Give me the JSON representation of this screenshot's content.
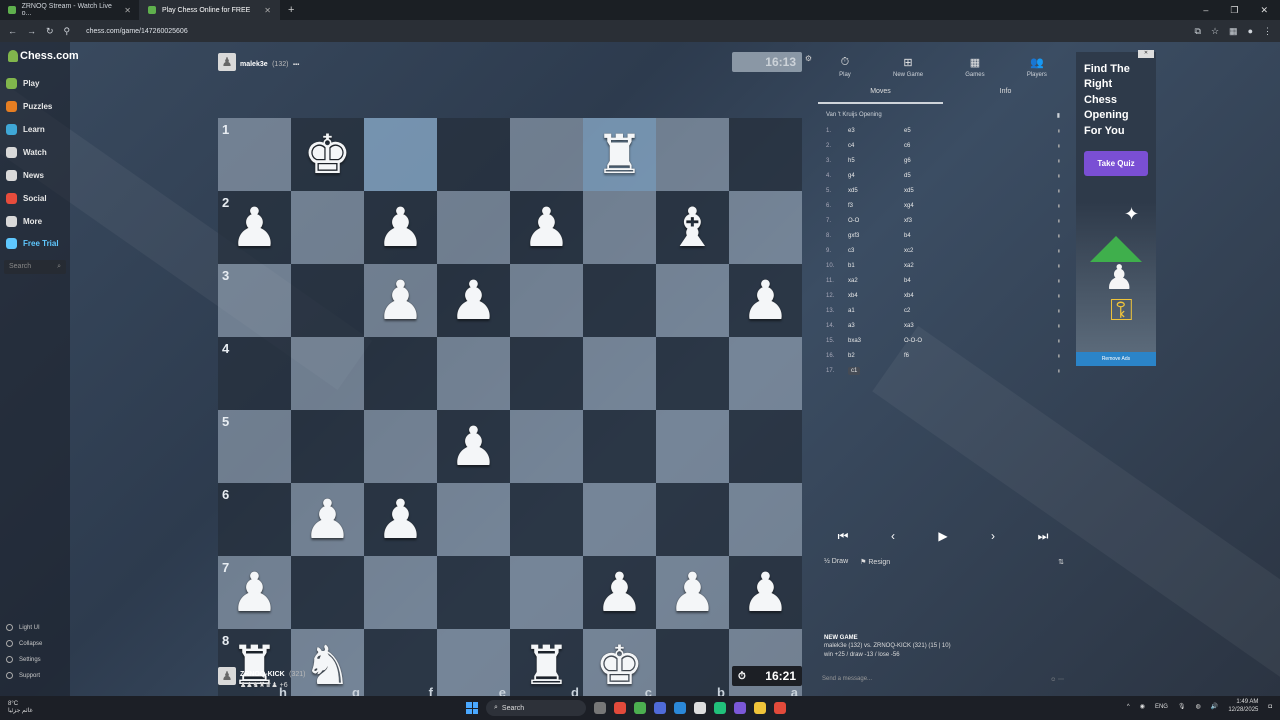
{
  "browser": {
    "tabs": [
      {
        "label": "ZRNOQ Stream - Watch Live o..."
      },
      {
        "label": "Play Chess Online for FREE"
      }
    ],
    "url": "chess.com/game/147260025606"
  },
  "sidebar": {
    "logo": "Chess.com",
    "items": [
      {
        "label": "Play",
        "color": "#81b64c"
      },
      {
        "label": "Puzzles",
        "color": "#e67e22"
      },
      {
        "label": "Learn",
        "color": "#3fa7d6"
      },
      {
        "label": "Watch",
        "color": "#d9d9d9"
      },
      {
        "label": "News",
        "color": "#d9d9d9"
      },
      {
        "label": "Social",
        "color": "#e74c3c"
      },
      {
        "label": "More",
        "color": "#d9d9d9"
      },
      {
        "label": "Free Trial",
        "color": "#5fc8ff"
      }
    ],
    "search_placeholder": "Search",
    "bottom": [
      {
        "label": "Light UI"
      },
      {
        "label": "Collapse"
      },
      {
        "label": "Settings"
      },
      {
        "label": "Support"
      }
    ]
  },
  "top_player": {
    "name": "malek3e",
    "rating": "(132)",
    "clock": "16:13"
  },
  "bottom_player": {
    "name": "ZRNOQ-KICK",
    "rating": "(321)",
    "extra": "+6",
    "clock": "16:21"
  },
  "board": {
    "ranks": [
      "1",
      "2",
      "3",
      "4",
      "5",
      "6",
      "7",
      "8"
    ],
    "files": [
      "h",
      "g",
      "f",
      "e",
      "d",
      "c",
      "b",
      "a"
    ],
    "squares": [
      [
        "",
        "wK",
        "",
        "",
        "",
        "wR",
        "",
        ""
      ],
      [
        "wP",
        "",
        "wP",
        "",
        "wP",
        "",
        "wB",
        ""
      ],
      [
        "",
        "",
        "wP",
        "wP",
        "",
        "",
        "",
        "wP"
      ],
      [
        "",
        "",
        "",
        "",
        "",
        "",
        "",
        ""
      ],
      [
        "",
        "",
        "",
        "wP",
        "",
        "",
        "",
        ""
      ],
      [
        "",
        "wP",
        "wP",
        "",
        "",
        "",
        "",
        ""
      ],
      [
        "wP",
        "",
        "",
        "",
        "",
        "wP",
        "wP",
        "wP"
      ],
      [
        "wR",
        "wN",
        "",
        "",
        "wR",
        "wK",
        "",
        ""
      ]
    ],
    "highlights": [
      [
        0,
        2
      ],
      [
        0,
        5
      ]
    ]
  },
  "panel": {
    "tabs": [
      {
        "label": "Play",
        "icon": "stopwatch-icon"
      },
      {
        "label": "New Game",
        "icon": "plus-icon"
      },
      {
        "label": "Games",
        "icon": "grid-icon"
      },
      {
        "label": "Players",
        "icon": "users-icon"
      }
    ],
    "subtabs": [
      {
        "label": "Moves"
      },
      {
        "label": "Info"
      }
    ],
    "opening": "Van 't Kruijs Opening",
    "moves": [
      {
        "n": "1.",
        "w": "e3",
        "b": "e5"
      },
      {
        "n": "2.",
        "w": "c4",
        "b": "c6"
      },
      {
        "n": "3.",
        "w": "h5",
        "b": "g6"
      },
      {
        "n": "4.",
        "w": "g4",
        "b": "d5"
      },
      {
        "n": "5.",
        "w": "xd5",
        "b": "xd5"
      },
      {
        "n": "6.",
        "w": "f3",
        "b": "xg4"
      },
      {
        "n": "7.",
        "w": "O-O",
        "b": "xf3"
      },
      {
        "n": "8.",
        "w": "gxf3",
        "b": "b4"
      },
      {
        "n": "9.",
        "w": "c3",
        "b": "xc2"
      },
      {
        "n": "10.",
        "w": "b1",
        "b": "xa2"
      },
      {
        "n": "11.",
        "w": "xa2",
        "b": "b4"
      },
      {
        "n": "12.",
        "w": "xb4",
        "b": "xb4"
      },
      {
        "n": "13.",
        "w": "a1",
        "b": "c2"
      },
      {
        "n": "14.",
        "w": "a3",
        "b": "xa3"
      },
      {
        "n": "15.",
        "w": "bxa3",
        "b": "O-O-O"
      },
      {
        "n": "16.",
        "w": "b2",
        "b": "f6"
      },
      {
        "n": "17.",
        "w": "c1",
        "b": ""
      }
    ],
    "draw": "Draw",
    "resign": "Resign",
    "new_game_title": "NEW GAME",
    "new_game_line1": "malek3e (132) vs. ZRNOQ-KICK (321) (15 | 10)",
    "new_game_line2": "win +25 / draw -13 / lose -56",
    "message_placeholder": "Send a message..."
  },
  "ad": {
    "headline": "Find The Right Chess Opening For You",
    "button": "Take Quiz",
    "remove": "Remove Ads"
  },
  "taskbar": {
    "weather_temp": "8°C",
    "weather_desc": "غائم جزئيا",
    "search": "Search",
    "lang": "ENG",
    "time": "1:49 AM",
    "date": "12/28/2025"
  }
}
